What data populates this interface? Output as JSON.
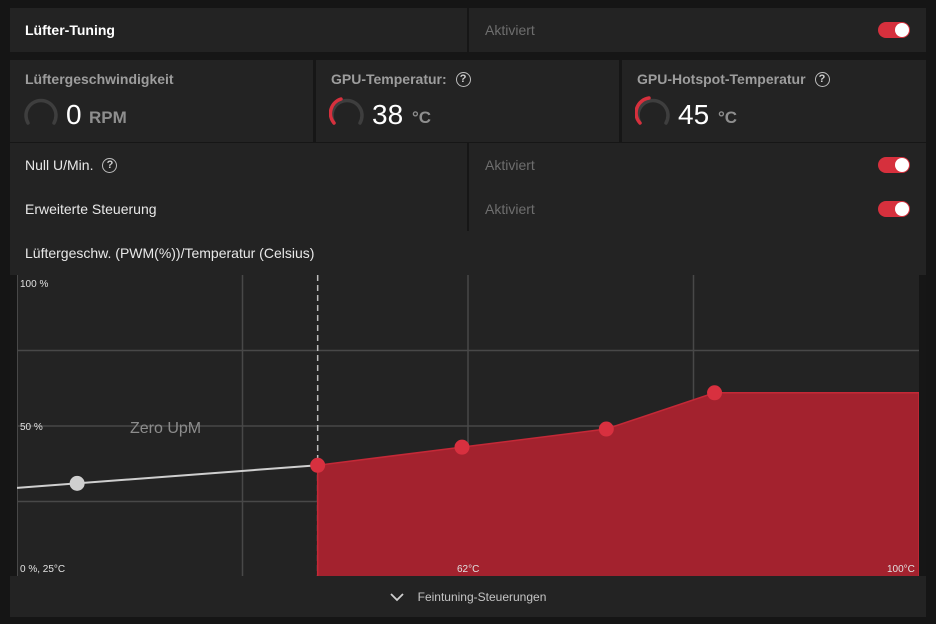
{
  "fan_tuning": {
    "title": "Lüfter-Tuning",
    "status": "Aktiviert",
    "enabled": true
  },
  "metrics": {
    "fan_speed": {
      "label": "Lüftergeschwindigkeit",
      "value": "0",
      "unit": "RPM"
    },
    "gpu_temp": {
      "label": "GPU-Temperatur:",
      "value": "38",
      "unit": "°C"
    },
    "hotspot_temp": {
      "label": "GPU-Hotspot-Temperatur",
      "value": "45",
      "unit": "°C"
    }
  },
  "zero_rpm": {
    "label": "Null U/Min.",
    "status": "Aktiviert",
    "enabled": true
  },
  "advanced": {
    "label": "Erweiterte Steuerung",
    "status": "Aktiviert",
    "enabled": true
  },
  "curve_header": {
    "label": "Lüftergeschw. (PWM(%))/Temperatur (Celsius)"
  },
  "chart_data": {
    "type": "area",
    "title": "",
    "xlabel": "Temperatur (Celsius)",
    "ylabel": "Lüftergeschw. (PWM(%))",
    "xlim": [
      25,
      100
    ],
    "ylim": [
      0,
      100
    ],
    "tick_labels": {
      "y_top": "100 %",
      "y_mid": "50 %",
      "origin": "0 %, 25°C",
      "x_mid": "62°C",
      "x_max": "100°C"
    },
    "zero_rpm_label": "Zero UpM",
    "zero_rpm_threshold_c": 50,
    "points": [
      {
        "x": 30,
        "y": 31,
        "kind": "zero-rpm"
      },
      {
        "x": 50,
        "y": 37,
        "kind": "curve"
      },
      {
        "x": 62,
        "y": 43,
        "kind": "curve"
      },
      {
        "x": 74,
        "y": 49,
        "kind": "curve"
      },
      {
        "x": 83,
        "y": 61,
        "kind": "curve"
      }
    ],
    "grid": true,
    "colors": {
      "fill": "#a3222e",
      "stroke": "#c42937",
      "point": "#d8303f",
      "zero_line": "#cfcfcf"
    }
  },
  "footer": {
    "label": "Feintuning-Steuerungen"
  },
  "icons": {
    "help": "help-circle-icon",
    "chevron": "chevron-down-icon"
  }
}
